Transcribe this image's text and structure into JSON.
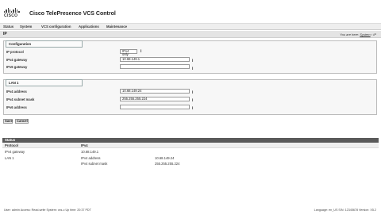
{
  "header": {
    "logo_text": "CISCO",
    "app_title": "Cisco TelePresence VCS Control"
  },
  "nav": {
    "items": [
      "Status",
      "System",
      "VCS configuration",
      "Applications",
      "Maintenance"
    ]
  },
  "titlebar": {
    "page_title": "IP",
    "crumb_prefix": "You are here:",
    "crumb_link": "System",
    "crumb_sep": "›",
    "crumb_current": "IP"
  },
  "configuration": {
    "section_label": "Configuration",
    "ip_protocol": {
      "label": "IP protocol",
      "value": "IPv4 only",
      "info": "i"
    },
    "ipv4_gateway": {
      "label": "IPv4 gateway",
      "value": "10.68.149.1",
      "info": "i"
    },
    "ipv6_gateway": {
      "label": "IPv6 gateway",
      "value": "",
      "info": "i"
    }
  },
  "lan1": {
    "section_label": "LAN 1",
    "ipv4_address": {
      "label": "IPv4 address",
      "value": "10.68.149.24",
      "info": "i"
    },
    "ipv4_subnet_mask": {
      "label": "IPv4 subnet mask",
      "value": "255.255.255.224",
      "info": "i"
    },
    "ipv6_address": {
      "label": "IPv6 address",
      "value": "",
      "info": "i"
    }
  },
  "buttons": {
    "save": "Save",
    "cancel": "Cancel"
  },
  "status": {
    "title": "Status",
    "protocol_label": "Protocol",
    "protocol_value": "IPv4",
    "gateway_label": "IPv4 gateway",
    "gateway_value": "10.68.149.1",
    "lan1_label": "LAN 1",
    "lan_rows": [
      {
        "label": "IPv4 address",
        "value": "10.68.149.24"
      },
      {
        "label": "IPv4 subnet mask",
        "value": "255.255.255.224"
      }
    ]
  },
  "footer": {
    "left": "User: admin Access: Read-write System: vcs-c Up time: 20:37 PDT",
    "right": "Language: en_US S/N: 12345678 Version: X5.2"
  }
}
